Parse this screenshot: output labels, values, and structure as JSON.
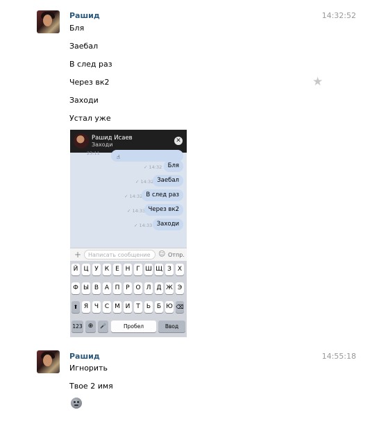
{
  "messages": [
    {
      "author": "Рашид",
      "time": "14:32:52",
      "lines": [
        "Бля",
        "Заебал",
        "В след раз",
        "Через вк2",
        "Заходи",
        "Устал уже"
      ]
    },
    {
      "author": "Рашид",
      "time": "14:55:18",
      "lines": [
        "Игнорить",
        "Твое 2 имя"
      ]
    }
  ],
  "attachment": {
    "header": {
      "name": "Рашид Исаев",
      "status": "Заходи",
      "close_glyph": "✕"
    },
    "chat": {
      "first_time": "23:11",
      "bubbles": [
        {
          "text": "Бля",
          "time": "14:32"
        },
        {
          "text": "Заебал",
          "time": "14:32"
        },
        {
          "text": "В след раз",
          "time": "14:32"
        },
        {
          "text": "Через вк2",
          "time": "14:33"
        },
        {
          "text": "Заходи",
          "time": "14:33"
        }
      ]
    },
    "input": {
      "placeholder": "Написать сообщение",
      "send_label": "Отпр.",
      "plus_glyph": "+",
      "smile_glyph": "☺"
    },
    "keyboard": {
      "row1": [
        "Й",
        "Ц",
        "У",
        "К",
        "Е",
        "Н",
        "Г",
        "Ш",
        "Щ",
        "З",
        "Х"
      ],
      "row2": [
        "Ф",
        "Ы",
        "В",
        "А",
        "П",
        "Р",
        "О",
        "Л",
        "Д",
        "Ж",
        "Э"
      ],
      "row3": [
        "Я",
        "Ч",
        "С",
        "М",
        "И",
        "Т",
        "Ь",
        "Б",
        "Ю"
      ],
      "shift": "⬆",
      "backspace": "⌫",
      "numbers": "123",
      "globe": "⊕",
      "mic": "🎤",
      "space": "Пробел",
      "enter": "Ввод"
    }
  },
  "icons": {
    "favorite": "star-icon",
    "emoji": "emoji-icon"
  },
  "colors": {
    "author": "#2b587a",
    "time": "#999999",
    "bubble": "#c9d9f0"
  }
}
